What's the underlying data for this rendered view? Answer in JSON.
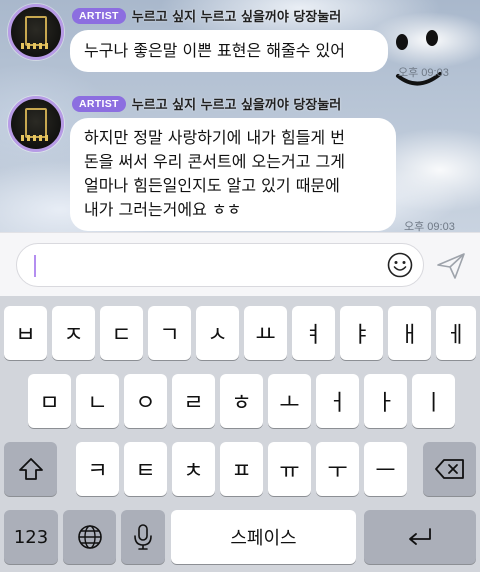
{
  "messages": [
    {
      "badge": "ARTIST",
      "sender": "누르고 싶지 누르고 싶을꺼야 당장눌러",
      "lines": [
        "누구나 좋은말 이쁜 표현은 해줄수 있어"
      ],
      "time": "오후 09:03"
    },
    {
      "badge": "ARTIST",
      "sender": "누르고 싶지 누르고 싶을꺼야 당장눌러",
      "lines": [
        "하지만 정말 사랑하기에 내가 힘들게 번",
        "돈을 써서 우리 콘서트에 오는거고 그게",
        "얼마나 힘든일인지도 알고 있기 때문에",
        "내가 그러는거에요 ㅎㅎ"
      ],
      "time": "오후 09:03"
    }
  ],
  "input": {
    "value": "",
    "placeholder": "",
    "emoji_icon": "smiley-icon",
    "send_icon": "paper-plane-icon"
  },
  "keyboard": {
    "row1": [
      "ㅂ",
      "ㅈ",
      "ㄷ",
      "ㄱ",
      "ㅅ",
      "ㅛ",
      "ㅕ",
      "ㅑ",
      "ㅐ",
      "ㅔ"
    ],
    "row2": [
      "ㅁ",
      "ㄴ",
      "ㅇ",
      "ㄹ",
      "ㅎ",
      "ㅗ",
      "ㅓ",
      "ㅏ",
      "ㅣ"
    ],
    "row3": [
      "ㅋ",
      "ㅌ",
      "ㅊ",
      "ㅍ",
      "ㅠ",
      "ㅜ",
      "ㅡ"
    ],
    "shift_icon": "shift-icon",
    "backspace_icon": "backspace-icon",
    "numbers_label": "123",
    "globe_icon": "globe-icon",
    "mic_icon": "microphone-icon",
    "space_label": "스페이스",
    "return_icon": "return-icon"
  },
  "colors": {
    "badge": "#8c6ee0",
    "caret": "#b48ef0",
    "avatar_ring": "#b79be6"
  }
}
